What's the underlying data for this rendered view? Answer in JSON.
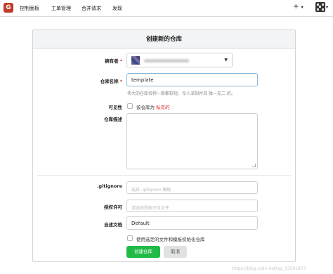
{
  "nav": {
    "logo_text": "G",
    "items": [
      "控制面板",
      "工单管理",
      "合并请求",
      "发现"
    ],
    "plus": "+",
    "caret": "▾"
  },
  "form": {
    "title": "创建新的仓库",
    "owner_label": "拥有者",
    "repo_name_label": "仓库名称",
    "repo_name_value": "template",
    "repo_name_help": "伟大的仓库名称一般都较短、令人深刻并且 独一无二 的。",
    "visibility_label": "可见性",
    "visibility_option_prefix": "该仓库为",
    "visibility_option_private": "私有的",
    "description_label": "仓库描述",
    "gitignore_label": ".gitignore",
    "gitignore_placeholder": "选择 .gitignore 模板",
    "license_label": "授权许可",
    "license_placeholder": "请选择授权许可文件",
    "readme_label": "自述文档",
    "readme_value": "Default",
    "init_option": "使用选定的文件和模板初始化仓库",
    "required_mark": "*",
    "submit_label": "创建仓库",
    "cancel_label": "取消"
  },
  "watermark": "https://blog.csdn.net/qq_33591873"
}
